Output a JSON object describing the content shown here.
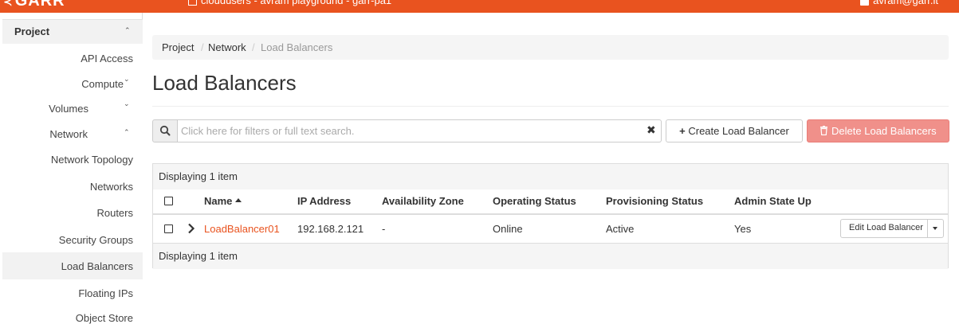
{
  "topbar": {
    "brand": "GARR",
    "project_selector": "cloudusers - avram playground - garr-pa1",
    "user": "avram@garr.it"
  },
  "sidebar": {
    "section": "Project",
    "items": [
      {
        "label": "API Access"
      },
      {
        "label": "Compute"
      },
      {
        "label": "Volumes"
      },
      {
        "label": "Network"
      },
      {
        "label": "Network Topology"
      },
      {
        "label": "Networks"
      },
      {
        "label": "Routers"
      },
      {
        "label": "Security Groups"
      },
      {
        "label": "Load Balancers"
      },
      {
        "label": "Floating IPs"
      },
      {
        "label": "Object Store"
      }
    ]
  },
  "breadcrumb": [
    "Project",
    "/",
    "Network",
    "/",
    "Load Balancers"
  ],
  "page_title": "Load Balancers",
  "search": {
    "placeholder": "Click here for filters or full text search."
  },
  "actions": {
    "create": "Create Load Balancer",
    "delete": "Delete Load Balancers"
  },
  "table": {
    "count_text": "Displaying 1 item",
    "columns": [
      "Name",
      "IP Address",
      "Availability Zone",
      "Operating Status",
      "Provisioning Status",
      "Admin State Up"
    ],
    "rows": [
      {
        "name": "LoadBalancer01",
        "ip": "192.168.2.121",
        "zone": "-",
        "operating_status": "Online",
        "provisioning_status": "Active",
        "admin_state": "Yes",
        "action": "Edit Load Balancer"
      }
    ]
  },
  "colors": {
    "brand": "#e9531f",
    "danger": "#f0908a"
  }
}
